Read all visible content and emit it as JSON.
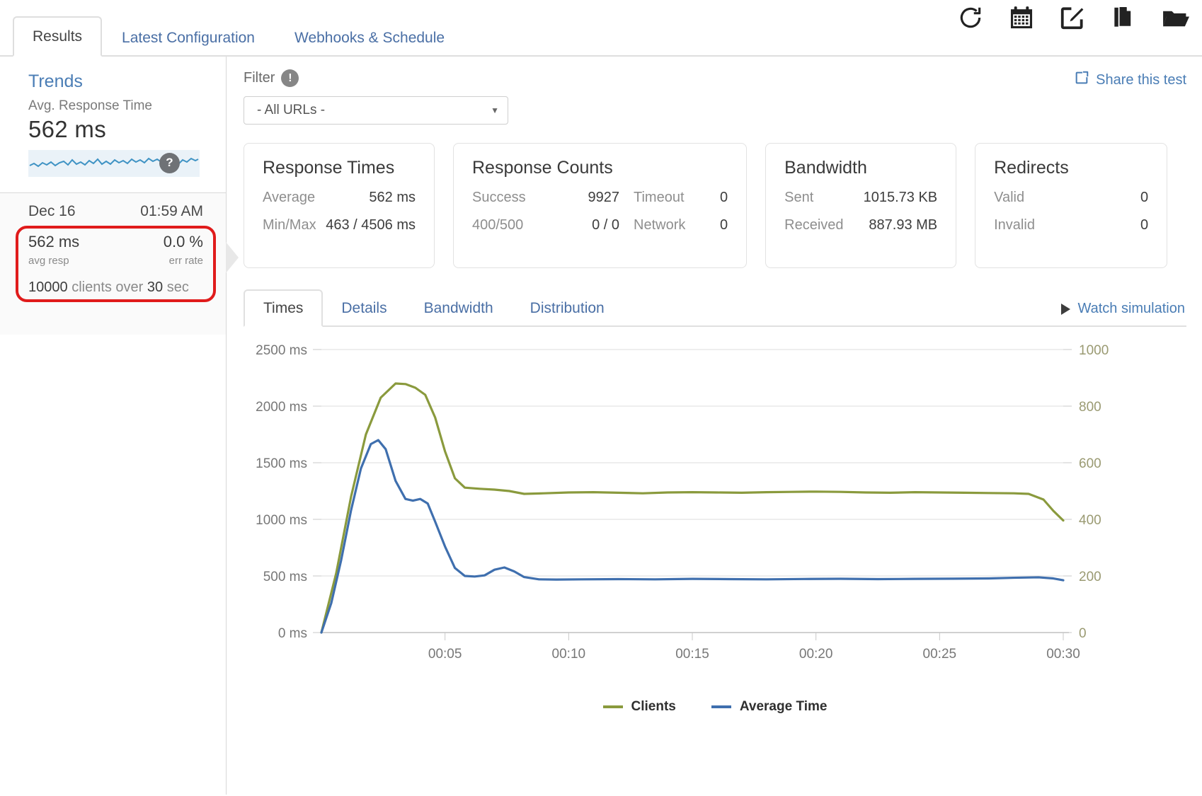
{
  "header": {
    "tabs": [
      {
        "label": "Results",
        "active": true
      },
      {
        "label": "Latest Configuration",
        "active": false
      },
      {
        "label": "Webhooks & Schedule",
        "active": false
      }
    ],
    "icons": [
      {
        "name": "refresh-icon"
      },
      {
        "name": "calendar-icon"
      },
      {
        "name": "edit-icon"
      },
      {
        "name": "document-icon"
      },
      {
        "name": "folder-icon"
      }
    ]
  },
  "sidebar": {
    "title": "Trends",
    "metric_label": "Avg. Response Time",
    "metric_value": "562 ms",
    "help_badge": "?",
    "run": {
      "date": "Dec 16",
      "time": "01:59 AM",
      "avg_resp_value": "562 ms",
      "avg_resp_label": "avg resp",
      "err_rate_value": "0.0 %",
      "err_rate_label": "err rate",
      "clients_count": "10000",
      "clients_text_1": "clients over",
      "duration": "30",
      "clients_text_2": "sec"
    }
  },
  "filter": {
    "label": "Filter",
    "info_badge": "!",
    "selected": "- All URLs -",
    "caret": "▼"
  },
  "share": {
    "label": "Share this test",
    "icon": "share-icon"
  },
  "cards": [
    {
      "title": "Response Times",
      "layout": "two-col",
      "rows": [
        {
          "k": "Average",
          "v": "562 ms"
        },
        {
          "k": "Min/Max",
          "v": "463 / 4506 ms"
        }
      ]
    },
    {
      "title": "Response Counts",
      "layout": "four-col",
      "rows": [
        {
          "k1": "Success",
          "v1": "9927",
          "k2": "Timeout",
          "v2": "0"
        },
        {
          "k1": "400/500",
          "v1": "0 / 0",
          "k2": "Network",
          "v2": "0"
        }
      ]
    },
    {
      "title": "Bandwidth",
      "layout": "two-col",
      "rows": [
        {
          "k": "Sent",
          "v": "1015.73 KB"
        },
        {
          "k": "Received",
          "v": "887.93 MB"
        }
      ]
    },
    {
      "title": "Redirects",
      "layout": "two-col",
      "rows": [
        {
          "k": "Valid",
          "v": "0"
        },
        {
          "k": "Invalid",
          "v": "0"
        }
      ]
    }
  ],
  "chart_tabs": [
    {
      "label": "Times",
      "active": true
    },
    {
      "label": "Details",
      "active": false
    },
    {
      "label": "Bandwidth",
      "active": false
    },
    {
      "label": "Distribution",
      "active": false
    }
  ],
  "watch": {
    "label": "Watch simulation",
    "icon": "play-icon"
  },
  "colors": {
    "clients": "#8a9a3d",
    "average_time": "#3f6fae",
    "link": "#4a7db5",
    "highlight": "#e01b1b",
    "axis_right": "#8a8a6a"
  },
  "chart_data": {
    "type": "line",
    "title": "",
    "xlabel": "",
    "grid": true,
    "legend_position": "bottom",
    "x_ticks": [
      "00:05",
      "00:10",
      "00:15",
      "00:20",
      "00:25",
      "00:30"
    ],
    "x_tick_seconds": [
      5,
      10,
      15,
      20,
      25,
      30
    ],
    "xlim": [
      0,
      30
    ],
    "axes": [
      {
        "id": "left",
        "label": "Average Time",
        "unit": "ms",
        "ylim": [
          0,
          2500
        ],
        "ticks": [
          0,
          500,
          1000,
          1500,
          2000,
          2500
        ],
        "tick_labels": [
          "0 ms",
          "500 ms",
          "1000 ms",
          "1500 ms",
          "2000 ms",
          "2500 ms"
        ]
      },
      {
        "id": "right",
        "label": "Clients",
        "unit": "",
        "ylim": [
          0,
          1000
        ],
        "ticks": [
          0,
          200,
          400,
          600,
          800,
          1000
        ],
        "tick_labels": [
          "0",
          "200",
          "400",
          "600",
          "800",
          "1000"
        ]
      }
    ],
    "series": [
      {
        "name": "Clients",
        "axis": "right",
        "color": "#8a9a3d",
        "x": [
          0.0,
          0.6,
          1.2,
          1.8,
          2.4,
          3.0,
          3.4,
          3.8,
          4.2,
          4.6,
          5.0,
          5.4,
          5.8,
          6.4,
          7.0,
          7.6,
          8.2,
          9.0,
          10.0,
          11.0,
          12.0,
          13.0,
          14.0,
          15.0,
          16.0,
          17.0,
          18.0,
          19.0,
          20.0,
          21.0,
          22.0,
          23.0,
          24.0,
          25.0,
          26.0,
          27.0,
          28.0,
          28.6,
          29.2,
          29.6,
          30.0
        ],
        "y": [
          0,
          210,
          480,
          700,
          830,
          880,
          878,
          865,
          840,
          760,
          640,
          545,
          512,
          508,
          505,
          500,
          490,
          492,
          495,
          496,
          494,
          492,
          495,
          496,
          495,
          494,
          496,
          497,
          498,
          497,
          495,
          494,
          496,
          495,
          494,
          493,
          492,
          490,
          470,
          430,
          396
        ]
      },
      {
        "name": "Average Time",
        "axis": "left",
        "color": "#3f6fae",
        "x": [
          0.0,
          0.4,
          0.8,
          1.2,
          1.6,
          2.0,
          2.3,
          2.6,
          3.0,
          3.4,
          3.7,
          4.0,
          4.3,
          4.6,
          5.0,
          5.4,
          5.8,
          6.2,
          6.6,
          7.0,
          7.4,
          7.8,
          8.2,
          8.8,
          9.5,
          10.5,
          12.0,
          13.5,
          15.0,
          16.5,
          18.0,
          19.5,
          21.0,
          22.5,
          24.0,
          25.5,
          27.0,
          28.0,
          29.0,
          29.6,
          30.0
        ],
        "y": [
          0,
          260,
          640,
          1080,
          1450,
          1665,
          1700,
          1620,
          1340,
          1180,
          1165,
          1180,
          1140,
          980,
          760,
          570,
          500,
          495,
          505,
          555,
          575,
          540,
          490,
          470,
          468,
          470,
          472,
          470,
          474,
          472,
          470,
          473,
          475,
          472,
          474,
          476,
          478,
          484,
          488,
          478,
          462
        ]
      }
    ],
    "legend": [
      {
        "name": "Clients",
        "color": "#8a9a3d"
      },
      {
        "name": "Average Time",
        "color": "#3f6fae"
      }
    ]
  }
}
